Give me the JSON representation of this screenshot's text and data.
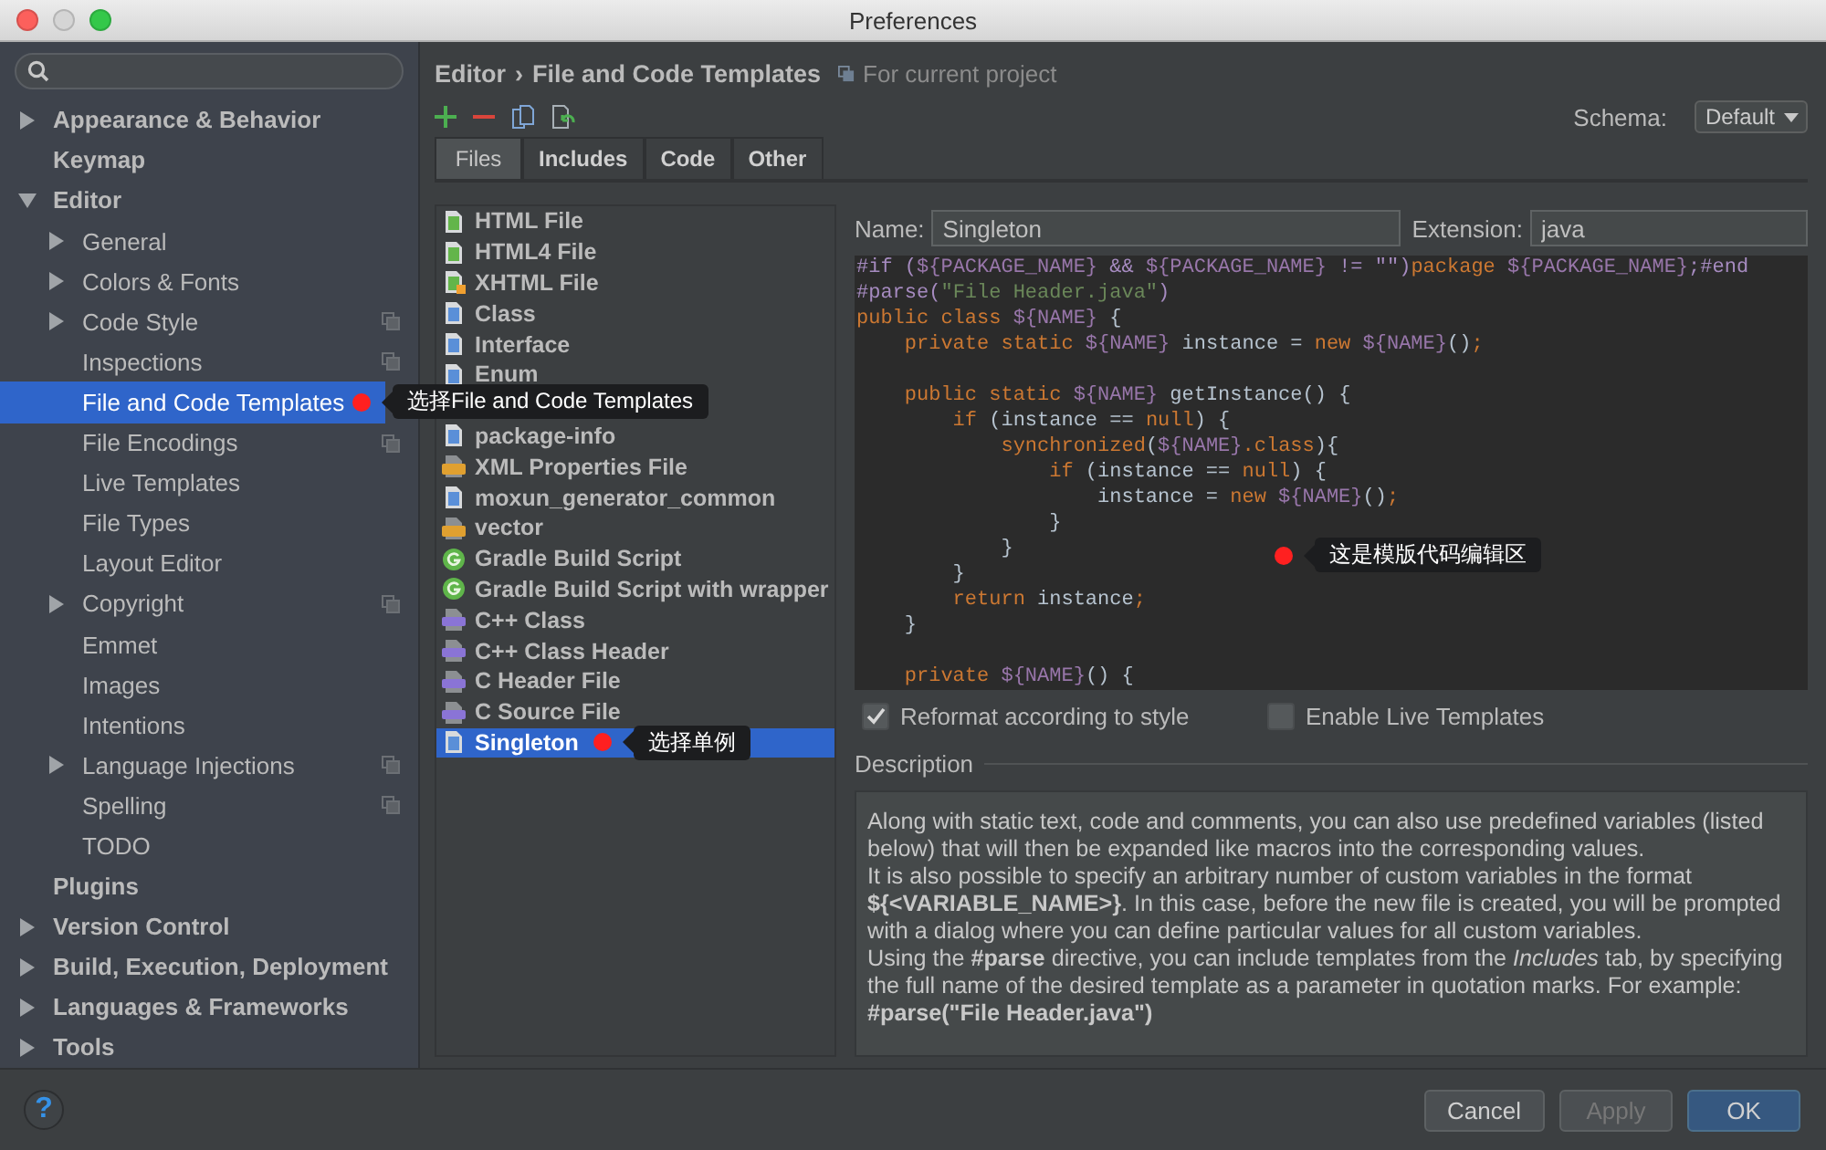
{
  "window": {
    "title": "Preferences"
  },
  "sidebar": {
    "items": [
      {
        "label": "Appearance & Behavior",
        "expanded": false,
        "selected": false
      },
      {
        "label": "Keymap",
        "selected": false
      },
      {
        "label": "Editor",
        "expanded": true,
        "selected": false,
        "children": [
          {
            "label": "General",
            "expanded": false,
            "selected": false
          },
          {
            "label": "Colors & Fonts",
            "expanded": false,
            "selected": false
          },
          {
            "label": "Code Style",
            "expanded": false,
            "selected": false,
            "per_project": true
          },
          {
            "label": "Inspections",
            "selected": false,
            "per_project": true
          },
          {
            "label": "File and Code Templates",
            "selected": true,
            "note": "选择File and Code Templates"
          },
          {
            "label": "File Encodings",
            "selected": false,
            "per_project": true
          },
          {
            "label": "Live Templates",
            "selected": false
          },
          {
            "label": "File Types",
            "selected": false
          },
          {
            "label": "Layout Editor",
            "selected": false
          },
          {
            "label": "Copyright",
            "expanded": false,
            "selected": false,
            "per_project": true
          },
          {
            "label": "Emmet",
            "selected": false
          },
          {
            "label": "Images",
            "selected": false
          },
          {
            "label": "Intentions",
            "selected": false
          },
          {
            "label": "Language Injections",
            "expanded": false,
            "selected": false,
            "per_project": true
          },
          {
            "label": "Spelling",
            "selected": false,
            "per_project": true
          },
          {
            "label": "TODO",
            "selected": false
          }
        ]
      },
      {
        "label": "Plugins",
        "selected": false
      },
      {
        "label": "Version Control",
        "expanded": false,
        "selected": false
      },
      {
        "label": "Build, Execution, Deployment",
        "expanded": false,
        "selected": false
      },
      {
        "label": "Languages & Frameworks",
        "expanded": false,
        "selected": false
      },
      {
        "label": "Tools",
        "expanded": false,
        "selected": false
      }
    ]
  },
  "breadcrumb": {
    "parent": "Editor",
    "separator": "›",
    "current": "File and Code Templates",
    "scope": "For current project"
  },
  "schema": {
    "label": "Schema:",
    "value": "Default"
  },
  "tabs": [
    {
      "label": "Files",
      "selected": true
    },
    {
      "label": "Includes",
      "selected": false
    },
    {
      "label": "Code",
      "selected": false
    },
    {
      "label": "Other",
      "selected": false
    }
  ],
  "templates": [
    {
      "name": "HTML File",
      "kind": "html",
      "selected": false
    },
    {
      "name": "HTML4 File",
      "kind": "html",
      "selected": false
    },
    {
      "name": "XHTML File",
      "kind": "xhtml",
      "selected": false
    },
    {
      "name": "Class",
      "kind": "java",
      "selected": false
    },
    {
      "name": "Interface",
      "kind": "java",
      "selected": false
    },
    {
      "name": "Enum",
      "kind": "java",
      "selected": false
    },
    {
      "name": "package-info",
      "kind": "java",
      "selected": false,
      "space_before": true
    },
    {
      "name": "XML Properties File",
      "kind": "xml",
      "selected": false
    },
    {
      "name": "moxun_generator_common",
      "kind": "java",
      "selected": false
    },
    {
      "name": "vector",
      "kind": "xml",
      "selected": false
    },
    {
      "name": "Gradle Build Script",
      "kind": "gradle",
      "selected": false
    },
    {
      "name": "Gradle Build Script with wrapper",
      "kind": "gradle",
      "selected": false
    },
    {
      "name": "C++ Class",
      "kind": "cpp",
      "selected": false
    },
    {
      "name": "C++ Class Header",
      "kind": "cpp",
      "selected": false
    },
    {
      "name": "C Header File",
      "kind": "cpp",
      "selected": false
    },
    {
      "name": "C Source File",
      "kind": "cpp",
      "selected": false
    },
    {
      "name": "Singleton",
      "kind": "java",
      "selected": true,
      "note": "选择单例"
    }
  ],
  "name_field": {
    "label": "Name:",
    "value": "Singleton"
  },
  "extension_field": {
    "label": "Extension:",
    "value": "java"
  },
  "editor": {
    "note": "这是模版代码编辑区",
    "lines": [
      {
        "segments": [
          {
            "kind": "dir",
            "text": "#if ("
          },
          {
            "kind": "var",
            "text": "${PACKAGE_NAME}"
          },
          {
            "kind": "dir",
            "text": " && "
          },
          {
            "kind": "var",
            "text": "${PACKAGE_NAME}"
          },
          {
            "kind": "dir",
            "text": " != \"\")"
          },
          {
            "kind": "kw",
            "text": "package "
          },
          {
            "kind": "var",
            "text": "${PACKAGE_NAME}"
          },
          {
            "kind": "dir",
            "text": ";#end"
          }
        ]
      },
      {
        "segments": [
          {
            "kind": "dir",
            "text": "#parse("
          },
          {
            "kind": "str",
            "text": "\"File Header.java\""
          },
          {
            "kind": "dir",
            "text": ")"
          }
        ]
      },
      {
        "segments": [
          {
            "kind": "kw",
            "text": "public class "
          },
          {
            "kind": "var",
            "text": "${NAME}"
          },
          {
            "kind": "plain",
            "text": " {"
          }
        ]
      },
      {
        "segments": [
          {
            "kind": "kw",
            "text": "    private static "
          },
          {
            "kind": "var",
            "text": "${NAME}"
          },
          {
            "kind": "plain",
            "text": " instance = "
          },
          {
            "kind": "kw",
            "text": "new "
          },
          {
            "kind": "var",
            "text": "${NAME}"
          },
          {
            "kind": "plain",
            "text": "()"
          },
          {
            "kind": "kw",
            "text": ";"
          }
        ]
      },
      {
        "space_before": true,
        "segments": [
          {
            "kind": "kw",
            "text": "    public static "
          },
          {
            "kind": "var",
            "text": "${NAME}"
          },
          {
            "kind": "plain",
            "text": " getInstance() {"
          }
        ]
      },
      {
        "segments": [
          {
            "kind": "kw",
            "text": "        if "
          },
          {
            "kind": "plain",
            "text": "(instance == "
          },
          {
            "kind": "kw",
            "text": "null"
          },
          {
            "kind": "plain",
            "text": ") {"
          }
        ]
      },
      {
        "segments": [
          {
            "kind": "kw",
            "text": "            synchronized"
          },
          {
            "kind": "plain",
            "text": "("
          },
          {
            "kind": "var",
            "text": "${NAME}"
          },
          {
            "kind": "kw",
            "text": ".class"
          },
          {
            "kind": "plain",
            "text": "){"
          }
        ]
      },
      {
        "segments": [
          {
            "kind": "kw",
            "text": "                if "
          },
          {
            "kind": "plain",
            "text": "(instance == "
          },
          {
            "kind": "kw",
            "text": "null"
          },
          {
            "kind": "plain",
            "text": ") {"
          }
        ]
      },
      {
        "segments": [
          {
            "kind": "plain",
            "text": "                    instance = "
          },
          {
            "kind": "kw",
            "text": "new "
          },
          {
            "kind": "var",
            "text": "${NAME}"
          },
          {
            "kind": "plain",
            "text": "()"
          },
          {
            "kind": "kw",
            "text": ";"
          }
        ]
      },
      {
        "segments": [
          {
            "kind": "plain",
            "text": "                }"
          }
        ]
      },
      {
        "segments": [
          {
            "kind": "plain",
            "text": "            }"
          }
        ]
      },
      {
        "segments": [
          {
            "kind": "plain",
            "text": "        }"
          }
        ]
      },
      {
        "segments": [
          {
            "kind": "kw",
            "text": "        return "
          },
          {
            "kind": "plain",
            "text": "instance"
          },
          {
            "kind": "kw",
            "text": ";"
          }
        ]
      },
      {
        "segments": [
          {
            "kind": "plain",
            "text": "    }"
          }
        ]
      },
      {
        "space_before": true,
        "segments": [
          {
            "kind": "kw",
            "text": "    private "
          },
          {
            "kind": "var",
            "text": "${NAME}"
          },
          {
            "kind": "plain",
            "text": "() {"
          }
        ]
      }
    ]
  },
  "options": [
    {
      "label": "Reformat according to style",
      "checked": true
    },
    {
      "label": "Enable Live Templates",
      "checked": false
    }
  ],
  "description": {
    "title": "Description",
    "paragraphs": [
      "Along with static text, code and comments, you can also use predefined variables (listed below) that will then be expanded like macros into the corresponding values.",
      "It is also possible to specify an arbitrary number of custom variables in the format **${<VARIABLE_NAME>}**. In this case, before the new file is created, you will be prompted with a dialog where you can define particular values for all custom variables.",
      "Using the **#parse** directive, you can include templates from the *Includes* tab, by specifying the full name of the desired template as a parameter in quotation marks. For example:",
      "**#parse(\"File Header.java\")**"
    ]
  },
  "footer": {
    "help": "?",
    "buttons": [
      {
        "label": "Cancel",
        "kind": "normal",
        "disabled": false
      },
      {
        "label": "Apply",
        "kind": "normal",
        "disabled": true
      },
      {
        "label": "OK",
        "kind": "default",
        "disabled": false
      }
    ]
  }
}
